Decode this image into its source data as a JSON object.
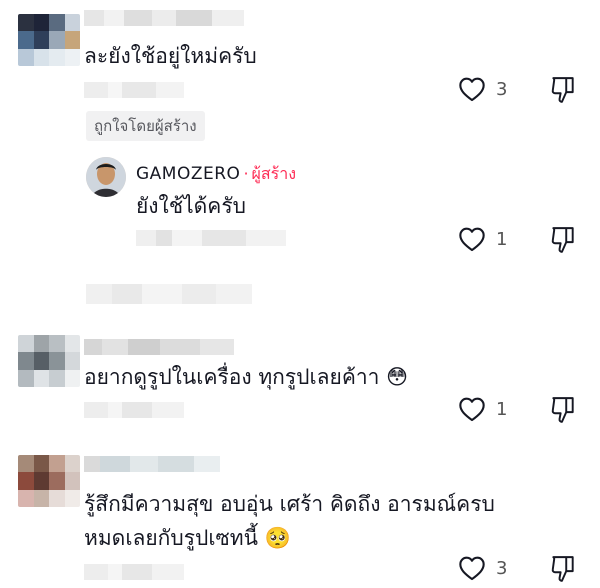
{
  "comments": [
    {
      "text": "ละยังใช้อยู่ใหม่ครับ",
      "likes": "3",
      "liked_by_creator": "ถูกใจโดยผู้สร้าง"
    },
    {
      "text": "อยากดูรูปในเครื่อง ทุกรูปเลยค้าา",
      "likes": "1"
    },
    {
      "text_line1": "รู้สึกมีความสุข อบอุ่น เศร้า คิดถึง อารมณ์ครบ",
      "text_line2": "หมดเลยกับรูปเซทนี้",
      "likes": "3"
    }
  ],
  "reply": {
    "author": "GAMOZERO",
    "separator": "·",
    "creator_tag": "ผู้สร้าง",
    "text": "ยังใช้ได้ครับ",
    "likes": "1"
  },
  "icons": {
    "like": "heart-outline-icon",
    "dislike": "thumbs-down-icon",
    "emoji_flushed": "😳",
    "emoji_pleading": "🥺"
  },
  "colors": {
    "creator_accent": "#fe2c55",
    "text": "#161823",
    "muted": "#555555"
  }
}
